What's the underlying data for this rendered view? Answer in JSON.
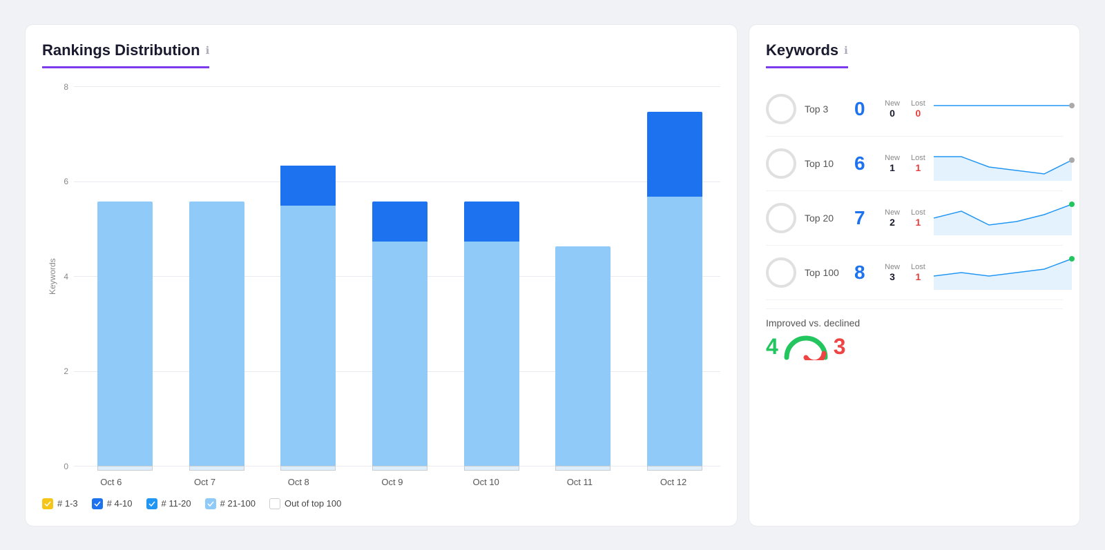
{
  "leftCard": {
    "title": "Rankings Distribution",
    "yAxisLabel": "Keywords",
    "gridLines": [
      8,
      6,
      4,
      2,
      0
    ],
    "bars": [
      {
        "date": "Oct 6",
        "top3": 0,
        "top10": 0,
        "top20": 0,
        "top100": 5.9,
        "out": 0.1,
        "total": 6
      },
      {
        "date": "Oct 7",
        "top3": 0,
        "top10": 0,
        "top20": 0,
        "top100": 5.9,
        "out": 0.1,
        "total": 6
      },
      {
        "date": "Oct 8",
        "top3": 0,
        "top10": 0,
        "top20": 0.9,
        "top100": 5.8,
        "out": 0.1,
        "total": 7
      },
      {
        "date": "Oct 9",
        "top3": 0,
        "top10": 0,
        "top20": 0.9,
        "top100": 5,
        "out": 0.1,
        "total": 6
      },
      {
        "date": "Oct 10",
        "top3": 0,
        "top10": 0,
        "top20": 0.9,
        "top100": 5,
        "out": 0.1,
        "total": 6
      },
      {
        "date": "Oct 11",
        "top3": 0,
        "top10": 0,
        "top20": 0,
        "top100": 4.9,
        "out": 0.1,
        "total": 5
      },
      {
        "date": "Oct 12",
        "top3": 0,
        "top10": 0,
        "top20": 1.9,
        "top100": 6,
        "out": 0.1,
        "total": 8
      }
    ],
    "legend": [
      {
        "label": "# 1-3",
        "color": "#f5c518",
        "type": "fill"
      },
      {
        "label": "# 4-10",
        "color": "#1d72f0",
        "type": "fill"
      },
      {
        "label": "# 11-20",
        "color": "#2196f3",
        "type": "fill"
      },
      {
        "label": "# 21-100",
        "color": "#90caf9",
        "type": "fill"
      },
      {
        "label": "Out of top 100",
        "color": "#fff",
        "type": "outline"
      }
    ]
  },
  "rightCard": {
    "title": "Keywords",
    "rows": [
      {
        "label": "Top 3",
        "value": 0,
        "new": 0,
        "lost": 0,
        "color": "#1d72f0",
        "hasDot": true,
        "dotColor": "#aaa"
      },
      {
        "label": "Top 10",
        "value": 6,
        "new": 1,
        "lost": 1,
        "color": "#1d72f0",
        "hasDot": true,
        "dotColor": "#aaa"
      },
      {
        "label": "Top 20",
        "value": 7,
        "new": 2,
        "lost": 1,
        "color": "#1d72f0",
        "hasDot": true,
        "dotColor": "#22c55e"
      },
      {
        "label": "Top 100",
        "value": 8,
        "new": 3,
        "lost": 1,
        "color": "#1d72f0",
        "hasDot": true,
        "dotColor": "#22c55e"
      }
    ],
    "improved": {
      "label": "Improved vs. declined",
      "improved": 4,
      "declined": 3
    }
  },
  "infoIcon": "i"
}
